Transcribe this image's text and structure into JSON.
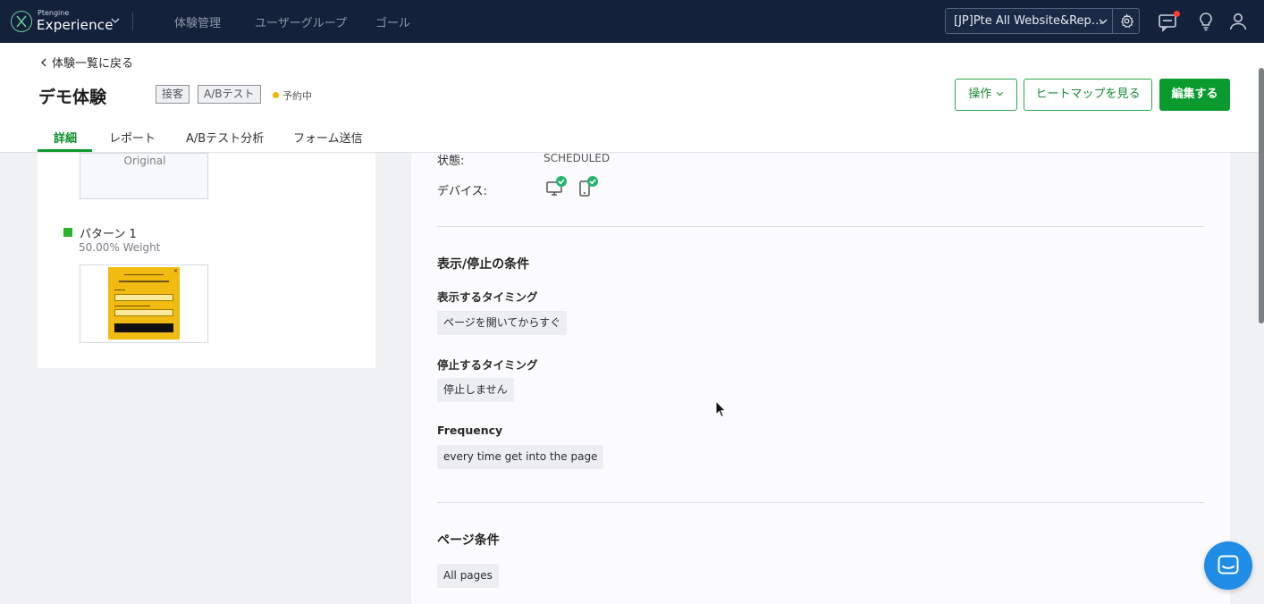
{
  "topnav": {
    "logo_small": "Ptengine",
    "logo_big": "Experience",
    "items": [
      "体験管理",
      "ユーザーグループ",
      "ゴール"
    ],
    "site_select": "[JP]Pte All Website&Rep…"
  },
  "header": {
    "back_label": "体験一覧に戻る",
    "title": "デモ体験",
    "tags": [
      "接客",
      "A/Bテスト"
    ],
    "status": "予約中",
    "status_color": "#f5b400",
    "buttons": {
      "operate": "操作",
      "heatmap": "ヒートマップを見る",
      "edit": "編集する"
    },
    "tabs": [
      "詳細",
      "レポート",
      "A/Bテスト分析",
      "フォーム送信"
    ],
    "active_tab": "詳細"
  },
  "variants": {
    "original_label": "Original",
    "pattern_name": "パターン 1",
    "pattern_weight": "50.00% Weight",
    "pattern_color": "#2bb52c"
  },
  "details": {
    "state_label": "状態:",
    "state_value": "SCHEDULED",
    "device_label": "デバイス:",
    "devices": [
      "desktop-icon",
      "mobile-icon"
    ]
  },
  "display_conditions": {
    "title": "表示/停止の条件",
    "show_timing_label": "表示するタイミング",
    "show_timing_value": "ページを開いてからすぐ",
    "stop_timing_label": "停止するタイミング",
    "stop_timing_value": "停止しません",
    "frequency_label": "Frequency",
    "frequency_value": "every time get into the page"
  },
  "page_conditions": {
    "title": "ページ条件",
    "value": "All pages"
  },
  "colors": {
    "nav_bg": "#13213a",
    "accent_green": "#0a9a2e",
    "chat_blue": "#1f8ce6"
  }
}
